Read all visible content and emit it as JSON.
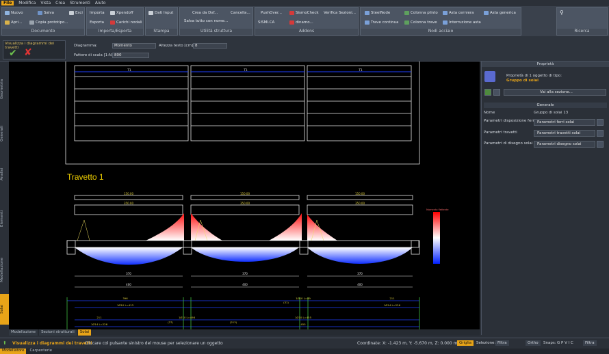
{
  "menu": {
    "items": [
      "File",
      "Modifica",
      "Vista",
      "Crea",
      "Strumenti",
      "Aiuto"
    ]
  },
  "ribbon": {
    "documento": {
      "title": "Documento",
      "nuovo": "Nuovo",
      "salva": "Salva",
      "esci": "Esci",
      "apri": "Apri...",
      "copia": "Copia prototipo..."
    },
    "importa": {
      "title": "Importa/Esporta",
      "importa": "Importa",
      "xpendoff": "Xpendoff",
      "esporta": "Esporta",
      "carichi": "Carichi nodali"
    },
    "stampa": {
      "title": "Stampa",
      "dati": "Dati Input"
    },
    "utilita": {
      "title": "Utilità struttura",
      "crea": "Crea da Dxf...",
      "cancella": "Cancella...",
      "salva_nome": "Salva tutto con nome..."
    },
    "addons": {
      "title": "Addons",
      "push": "PushOver...",
      "sismo": "SismoCheck",
      "verifica": "Verifica Sezioni...",
      "sismica": "SISMI.CA",
      "dinamo": "dinamo..."
    },
    "nodi": {
      "title": "Nodi acciaio",
      "steel": "SteelNode",
      "colonna_plinto": "Colonna plinto",
      "asta_cerniera": "Asta cerniera",
      "asta_generica": "Asta generica",
      "trave_continua": "Trave continua",
      "colonna_trave": "Colonna trave",
      "interruzione": "Interruzione asta"
    },
    "ricerca": {
      "title": "Ricerca"
    }
  },
  "command": {
    "title": "Visualizza i diagrammi dei travetti"
  },
  "options": {
    "diagramma_label": "Diagramma:",
    "diagramma_value": "Momento",
    "altezza_label": "Altezza testo [cm]:",
    "altezza_value": "8",
    "fattore_label": "Fattore di scala [1:N]:",
    "fattore_value": "800"
  },
  "lefttabs": [
    "Geometria",
    "Generali",
    "Analisi",
    "Elementi",
    "Modellazione",
    "Solai"
  ],
  "drawing": {
    "beam_title": "Travetto 1",
    "top_labels": [
      "T1",
      "T1",
      "T1"
    ],
    "box_upper": [
      "150.00",
      "150.00",
      "150.00"
    ],
    "box_lower": [
      "350.00",
      "350.00",
      "350.00"
    ],
    "dims_mid": [
      "370",
      "370",
      "370"
    ],
    "dims_bot": [
      "400",
      "400",
      "400"
    ],
    "rebar_top": [
      "396",
      "1Ø10 L=89",
      "211"
    ],
    "rebar_l1": [
      "1Ø10 L=413",
      "(31)",
      "1Ø14 L=226"
    ],
    "rebar_l2": [
      "211",
      "1Ø10 L=498",
      "1Ø10 L=455"
    ],
    "rebar_l3": [
      "1Ø14 L=226",
      "(27)",
      "(213)",
      "455"
    ],
    "legend_title": "Momento flettente"
  },
  "bottomtabs": [
    "Modellazione",
    "Sezioni strutturali",
    "Solai"
  ],
  "props": {
    "panel_title": "Proprietà",
    "heading_line1": "Proprietà di 1 oggetto di tipo:",
    "heading_line2": "Gruppo di solai",
    "goto": "Vai alla sezione...",
    "section": "Generale",
    "rows": [
      {
        "label": "Nome",
        "value": "Gruppo di solai 13"
      },
      {
        "label": "Parametri disposizione ferri",
        "value": "Parametri ferri solai"
      },
      {
        "label": "Parametri travetti",
        "value": "Parametri travetti solai"
      },
      {
        "label": "Parametri di disegno solai",
        "value": "Parametri disegno solai"
      }
    ]
  },
  "status": {
    "cmd": "Visualizza i diagrammi dei travetti",
    "hint": "Cliccare col pulsante sinistro del mouse per selezionare un oggetto",
    "coords": "Coordinate: X: -1.423 m, Y: -5.670 m, Z: 0.000 m",
    "griglia": "Griglia",
    "selezione": "Selezione:",
    "filtra": "Filtra",
    "ortho": "Ortho",
    "snaps": "Snaps:",
    "snap_letters": "G P V I C",
    "filtra2": "Filtra"
  },
  "statusbar2": [
    "Modellatore",
    "Carpenterie"
  ]
}
